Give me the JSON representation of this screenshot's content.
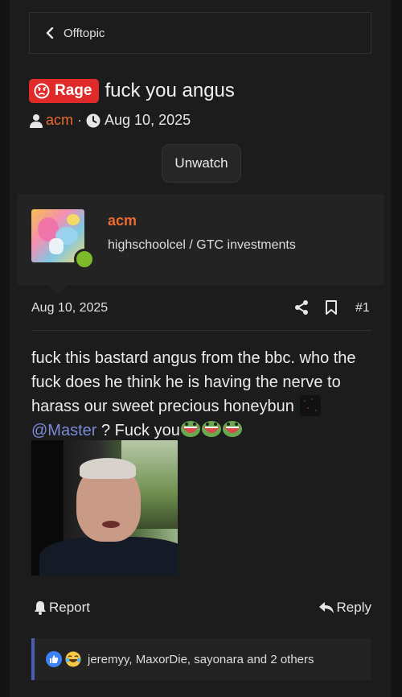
{
  "breadcrumb": {
    "label": "Offtopic"
  },
  "thread": {
    "prefix": "Rage",
    "title": "fuck you angus",
    "author": "acm",
    "separator": "·",
    "date": "Aug 10, 2025"
  },
  "watch_button": {
    "label": "Unwatch"
  },
  "user": {
    "name": "acm",
    "title": "highschoolcel / GTC investments",
    "status": "online"
  },
  "post": {
    "date": "Aug 10, 2025",
    "number": "#1",
    "line1": "fuck this bastard angus from the bbc. who the fuck does he think he is having the nerve to harass our sweet precious honeybun",
    "mention": "@Master",
    "line2": "? Fuck you",
    "image_alt": "video still of a man in a car"
  },
  "actions": {
    "report_label": "Report",
    "reply_label": "Reply"
  },
  "reactions": {
    "text": "jeremyy, MaxorDie, sayonara and 2 others"
  },
  "colors": {
    "accent": "#ea6a30",
    "prefix_bg": "#e02a2a",
    "mention": "#7b8ad6",
    "online": "#7dba2a",
    "reactions_border": "#4a5fb3"
  },
  "icons": {
    "breadcrumb": "chevron-left-icon",
    "prefix": "angry-face-icon",
    "author": "user-icon",
    "date": "clock-icon",
    "share": "share-icon",
    "bookmark": "bookmark-icon",
    "report": "bell-icon",
    "reply": "reply-icon",
    "like": "thumbs-up-icon",
    "laugh": "laughing-face-icon"
  }
}
